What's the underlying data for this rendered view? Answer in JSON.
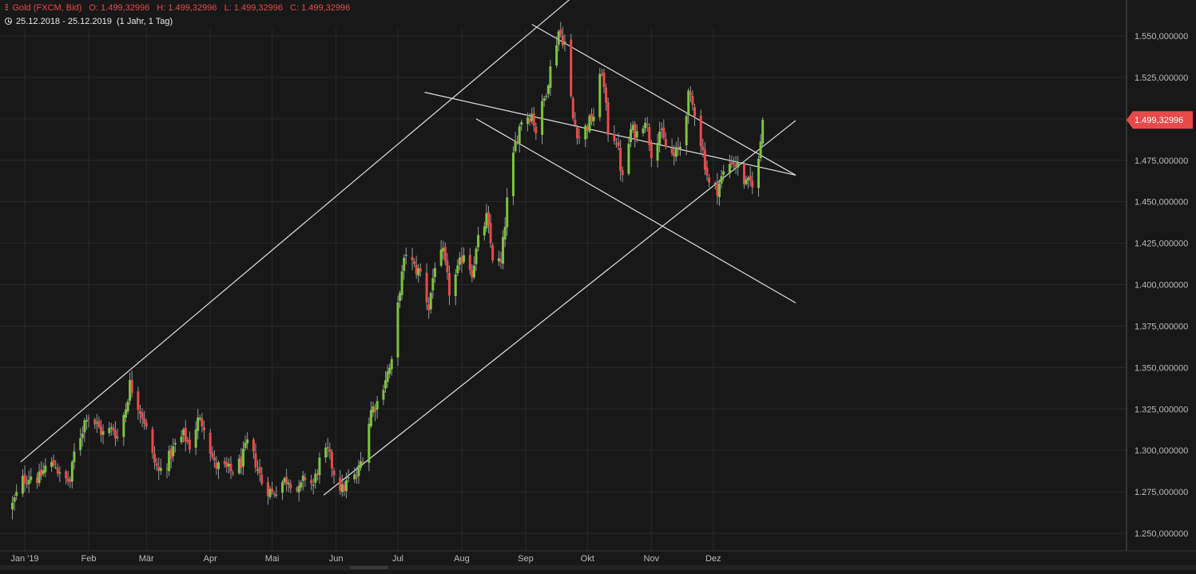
{
  "header": {
    "symbol_label": "Gold (FXCM, Bid)",
    "open_label": "O: 1.499,32996",
    "high_label": "H: 1.499,32996",
    "low_label": "L: 1.499,32996",
    "close_label": "C: 1.499,32996",
    "date_range": "25.12.2018 - 25.12.2019",
    "interval": "(1 Jahr, 1 Tag)"
  },
  "price_tag": "1.499,32996",
  "colors": {
    "background": "#181818",
    "up": "#7dc243",
    "down": "#e84a4a",
    "grid": "#2a2a2a",
    "trendline": "#e0e0e0",
    "axis_text": "#bbbbbb",
    "price_tag_bg": "#e84a4a"
  },
  "chart_data": {
    "type": "candlestick",
    "title": "Gold (FXCM, Bid)",
    "xlabel": "",
    "ylabel": "",
    "x_range": [
      "2018-12-25",
      "2019-12-25"
    ],
    "ylim": [
      1235,
      1575
    ],
    "y_ticks": [
      1250,
      1275,
      1300,
      1325,
      1350,
      1375,
      1400,
      1425,
      1450,
      1475,
      1500,
      1525,
      1550
    ],
    "y_tick_labels": [
      "1.250,000000",
      "1.275,000000",
      "1.300,000000",
      "1.325,000000",
      "1.350,000000",
      "1.375,000000",
      "1.400,000000",
      "1.425,000000",
      "1.450,000000",
      "1.475,000000",
      "1.500,000000",
      "1.525,000000",
      "1.550,000000"
    ],
    "x_ticks": [
      {
        "label": "Jan '19",
        "date": "2019-01-01"
      },
      {
        "label": "Feb",
        "date": "2019-02-01"
      },
      {
        "label": "Mär",
        "date": "2019-03-01"
      },
      {
        "label": "Apr",
        "date": "2019-04-01"
      },
      {
        "label": "Mai",
        "date": "2019-05-01"
      },
      {
        "label": "Jun",
        "date": "2019-06-01"
      },
      {
        "label": "Jul",
        "date": "2019-07-01"
      },
      {
        "label": "Aug",
        "date": "2019-08-01"
      },
      {
        "label": "Sep",
        "date": "2019-09-01"
      },
      {
        "label": "Okt",
        "date": "2019-10-01"
      },
      {
        "label": "Nov",
        "date": "2019-11-01"
      },
      {
        "label": "Dez",
        "date": "2019-12-01"
      }
    ],
    "grid": true,
    "last_price": 1499.33,
    "close_path": [
      [
        "2018-12-26",
        1267
      ],
      [
        "2018-12-31",
        1282
      ],
      [
        "2019-01-04",
        1285
      ],
      [
        "2019-01-08",
        1283
      ],
      [
        "2019-01-11",
        1290
      ],
      [
        "2019-01-16",
        1292
      ],
      [
        "2019-01-18",
        1284
      ],
      [
        "2019-01-23",
        1281
      ],
      [
        "2019-01-25",
        1298
      ],
      [
        "2019-01-29",
        1313
      ],
      [
        "2019-01-31",
        1322
      ],
      [
        "2019-02-05",
        1315
      ],
      [
        "2019-02-08",
        1310
      ],
      [
        "2019-02-13",
        1313
      ],
      [
        "2019-02-15",
        1308
      ],
      [
        "2019-02-19",
        1326
      ],
      [
        "2019-02-21",
        1340
      ],
      [
        "2019-02-25",
        1328
      ],
      [
        "2019-02-28",
        1318
      ],
      [
        "2019-03-04",
        1296
      ],
      [
        "2019-03-07",
        1287
      ],
      [
        "2019-03-11",
        1293
      ],
      [
        "2019-03-15",
        1303
      ],
      [
        "2019-03-19",
        1309
      ],
      [
        "2019-03-22",
        1303
      ],
      [
        "2019-03-26",
        1318
      ],
      [
        "2019-03-29",
        1316
      ],
      [
        "2019-04-03",
        1291
      ],
      [
        "2019-04-08",
        1289
      ],
      [
        "2019-04-11",
        1287
      ],
      [
        "2019-04-16",
        1293
      ],
      [
        "2019-04-19",
        1304
      ],
      [
        "2019-04-23",
        1293
      ],
      [
        "2019-04-26",
        1281
      ],
      [
        "2019-05-01",
        1274
      ],
      [
        "2019-05-06",
        1281
      ],
      [
        "2019-05-09",
        1283
      ],
      [
        "2019-05-14",
        1275
      ],
      [
        "2019-05-17",
        1284
      ],
      [
        "2019-05-21",
        1279
      ],
      [
        "2019-05-24",
        1293
      ],
      [
        "2019-05-28",
        1299
      ],
      [
        "2019-05-31",
        1287
      ],
      [
        "2019-06-04",
        1276
      ],
      [
        "2019-06-07",
        1282
      ],
      [
        "2019-06-11",
        1284
      ],
      [
        "2019-06-14",
        1297
      ],
      [
        "2019-06-18",
        1324
      ],
      [
        "2019-06-21",
        1329
      ],
      [
        "2019-06-25",
        1344
      ],
      [
        "2019-06-28",
        1352
      ],
      [
        "2019-07-02",
        1398
      ],
      [
        "2019-07-05",
        1420
      ],
      [
        "2019-07-09",
        1410
      ],
      [
        "2019-07-12",
        1407
      ],
      [
        "2019-07-16",
        1386
      ],
      [
        "2019-07-19",
        1413
      ],
      [
        "2019-07-23",
        1418
      ],
      [
        "2019-07-26",
        1396
      ],
      [
        "2019-07-30",
        1408
      ],
      [
        "2019-08-02",
        1420
      ],
      [
        "2019-08-06",
        1408
      ],
      [
        "2019-08-09",
        1426
      ],
      [
        "2019-08-13",
        1440
      ],
      [
        "2019-08-16",
        1417
      ],
      [
        "2019-08-20",
        1412
      ],
      [
        "2019-08-23",
        1450
      ],
      [
        "2019-08-27",
        1485
      ],
      [
        "2019-08-30",
        1500
      ],
      [
        "2019-09-04",
        1503
      ],
      [
        "2019-09-06",
        1493
      ],
      [
        "2019-09-10",
        1512
      ],
      [
        "2019-09-13",
        1530
      ],
      [
        "2019-09-17",
        1553
      ],
      [
        "2019-09-20",
        1546
      ],
      [
        "2019-09-24",
        1500
      ],
      [
        "2019-09-27",
        1489
      ],
      [
        "2019-10-01",
        1496
      ],
      [
        "2019-10-04",
        1502
      ],
      [
        "2019-10-08",
        1530
      ],
      [
        "2019-10-11",
        1493
      ],
      [
        "2019-10-15",
        1488
      ],
      [
        "2019-10-18",
        1463
      ],
      [
        "2019-10-22",
        1493
      ],
      [
        "2019-10-25",
        1491
      ],
      [
        "2019-10-29",
        1501
      ],
      [
        "2019-11-01",
        1480
      ],
      [
        "2019-11-05",
        1493
      ],
      [
        "2019-11-08",
        1483
      ],
      [
        "2019-11-12",
        1477
      ],
      [
        "2019-11-15",
        1484
      ],
      [
        "2019-11-19",
        1513
      ],
      [
        "2019-11-22",
        1505
      ],
      [
        "2019-11-26",
        1480
      ],
      [
        "2019-11-29",
        1460
      ],
      [
        "2019-12-03",
        1458
      ],
      [
        "2019-12-06",
        1467
      ],
      [
        "2019-12-10",
        1475
      ],
      [
        "2019-12-13",
        1471
      ],
      [
        "2019-12-17",
        1460
      ],
      [
        "2019-12-20",
        1462
      ],
      [
        "2019-12-23",
        1474
      ],
      [
        "2019-12-25",
        1499.33
      ]
    ]
  }
}
